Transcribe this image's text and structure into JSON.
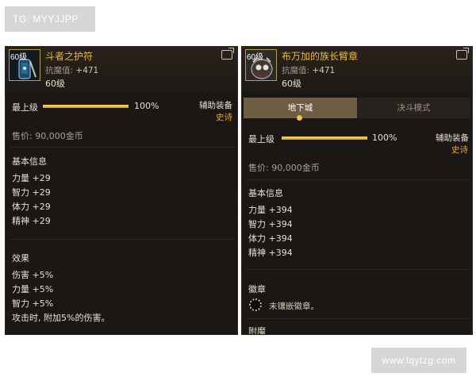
{
  "watermarks": {
    "top": "TG: MYYJJPP",
    "bottom": "www.lqytzg.com"
  },
  "left_panel": {
    "icon_level": "60级",
    "item_name": "斗者之护符",
    "stat_label": "抗魔值:",
    "stat_value": "+471",
    "req_level": "60级",
    "max_level_label": "最上级",
    "progress_percent": 100,
    "progress_text": "100%",
    "slot": "辅助装备",
    "rarity": "史诗",
    "price": "售价: 90,000金币",
    "basic_title": "基本信息",
    "basic_stats": [
      "力量 +29",
      "智力 +29",
      "体力 +29",
      "精神 +29"
    ],
    "effects_title": "效果",
    "effects": [
      "伤害 +5%",
      "力量 +5%",
      "智力 +5%",
      "攻击时, 附加5%的伤害。"
    ]
  },
  "right_panel": {
    "icon_level": "60级",
    "item_name": "布万加的族长臂章",
    "stat_label": "抗魔值:",
    "stat_value": "+471",
    "req_level": "60级",
    "tabs": [
      "地下城",
      "决斗模式"
    ],
    "max_level_label": "最上级",
    "progress_percent": 100,
    "progress_text": "100%",
    "slot": "辅助装备",
    "rarity": "史诗",
    "price": "售价: 90,000金币",
    "basic_title": "基本信息",
    "basic_stats": [
      "力量 +394",
      "智力 +394",
      "体力 +394",
      "精神 +394"
    ],
    "emblem_title": "徽章",
    "emblem_text": "未镶嵌徽章。",
    "enchant_title": "附魔"
  },
  "colors": {
    "item_name": "#e8b93c",
    "rarity": "#e8a23a",
    "panel_bg": "#1a1714",
    "tab_active": "#6e5c43"
  },
  "icons": [
    "amulet-item-icon",
    "armband-item-icon",
    "share-icon",
    "emblem-slot-icon"
  ]
}
